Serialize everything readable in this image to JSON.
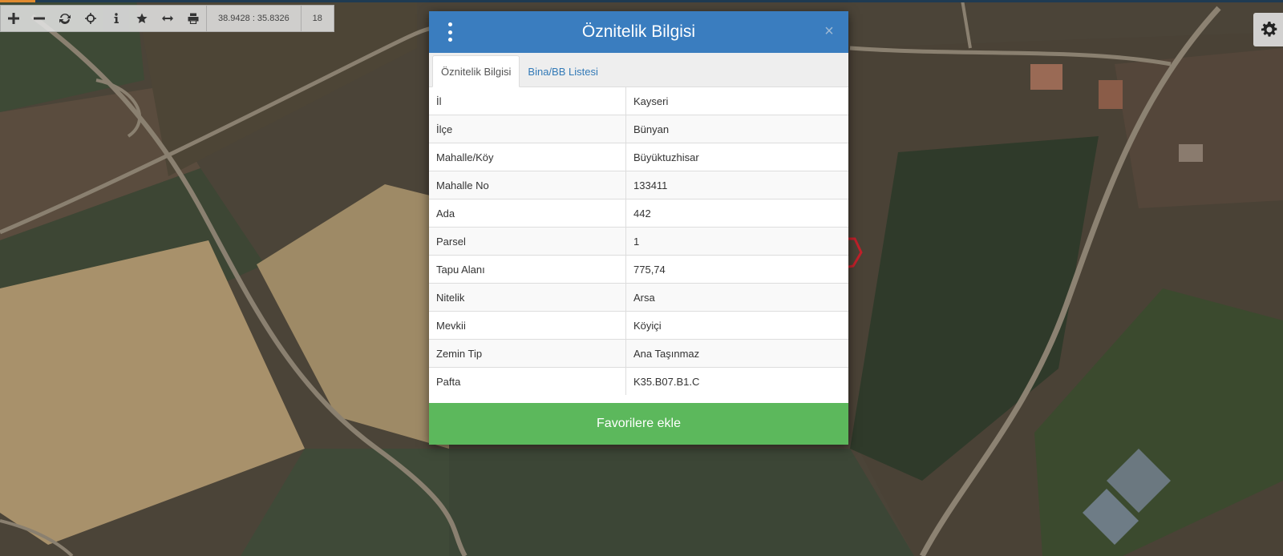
{
  "toolbar": {
    "buttons": [
      {
        "name": "zoom-in-button",
        "icon": "plus-icon"
      },
      {
        "name": "zoom-out-button",
        "icon": "minus-icon"
      },
      {
        "name": "refresh-button",
        "icon": "refresh-icon"
      },
      {
        "name": "locate-button",
        "icon": "crosshair-icon"
      },
      {
        "name": "info-button",
        "icon": "info-icon"
      },
      {
        "name": "favorites-button",
        "icon": "star-icon"
      },
      {
        "name": "measure-button",
        "icon": "arrows-horizontal-icon"
      },
      {
        "name": "print-button",
        "icon": "print-icon"
      }
    ],
    "coordinates": "38.9428 : 35.8326",
    "zoom_level": "18"
  },
  "settings": {
    "icon": "gear-icon"
  },
  "modal": {
    "title": "Öznitelik Bilgisi",
    "menu_icon": "kebab-menu-icon",
    "close_label": "×",
    "tabs": [
      {
        "label": "Öznitelik Bilgisi",
        "active": true
      },
      {
        "label": "Bina/BB Listesi",
        "active": false
      }
    ],
    "rows": [
      {
        "key": "İl",
        "value": "Kayseri"
      },
      {
        "key": "İlçe",
        "value": "Bünyan"
      },
      {
        "key": "Mahalle/Köy",
        "value": "Büyüktuzhisar"
      },
      {
        "key": "Mahalle No",
        "value": "133411"
      },
      {
        "key": "Ada",
        "value": "442"
      },
      {
        "key": "Parsel",
        "value": "1"
      },
      {
        "key": "Tapu Alanı",
        "value": "775,74"
      },
      {
        "key": "Nitelik",
        "value": "Arsa"
      },
      {
        "key": "Mevkii",
        "value": "Köyiçi"
      },
      {
        "key": "Zemin Tip",
        "value": "Ana Taşınmaz"
      },
      {
        "key": "Pafta",
        "value": "K35.B07.B1.C"
      }
    ],
    "favorite_button": "Favorilere ekle"
  },
  "colors": {
    "header": "#3a7dbf",
    "favorite_button": "#5cb85c",
    "tab_link": "#337ab7",
    "parcel_outline": "#c0202a"
  }
}
